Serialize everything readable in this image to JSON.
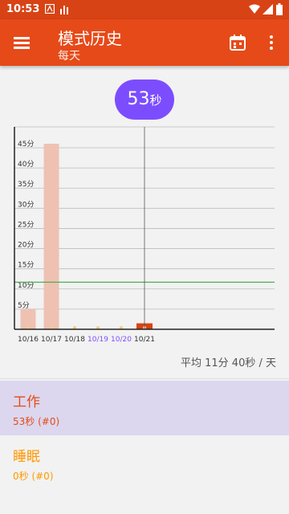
{
  "status_bar": {
    "time": "10:53"
  },
  "app_bar": {
    "title": "模式历史",
    "subtitle": "每天"
  },
  "total": {
    "value": "53",
    "unit": "秒"
  },
  "chart_data": {
    "type": "bar",
    "categories": [
      "10/16",
      "10/17",
      "10/18",
      "10/19",
      "10/20",
      "10/21"
    ],
    "values": [
      5,
      46,
      0,
      0,
      0,
      0.88
    ],
    "highlighted_categories": [
      "10/19",
      "10/20"
    ],
    "current_category": "10/21",
    "yunit": "分",
    "yticks": [
      "5分",
      "10分",
      "15分",
      "20分",
      "25分",
      "30分",
      "35分",
      "40分",
      "45分"
    ],
    "ylim": [
      0,
      50
    ],
    "average_line": 11.67,
    "colors": {
      "bar": "#efc1b3",
      "current": "#d84315",
      "avg_line": "#4caf50",
      "dot": "#ffcc80",
      "highlight_label": "#7c4dff"
    }
  },
  "average_text": "平均 11分 40秒 / 天",
  "modes": [
    {
      "name": "工作",
      "value": "53秒 (#0)",
      "color": "#e64a19",
      "bg": "#dcd7ee"
    },
    {
      "name": "睡眠",
      "value": "0秒 (#0)",
      "color": "#ff9800",
      "bg": "#f2f2f2"
    }
  ]
}
